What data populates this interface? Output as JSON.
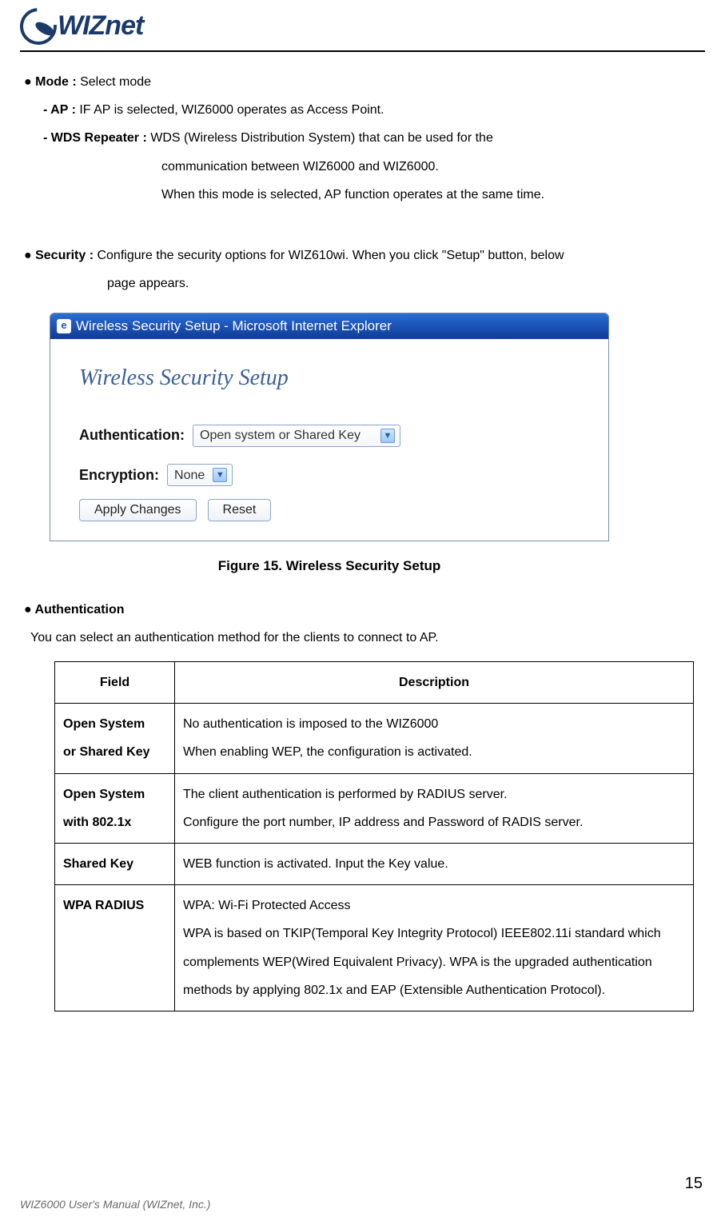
{
  "header": {
    "logo_text": "WIZnet"
  },
  "body": {
    "bullet_mode_label": "● Mode : ",
    "bullet_mode_value": "Select mode",
    "ap_label": "- AP : ",
    "ap_text": "IF AP is selected, WIZ6000 operates as Access Point.",
    "wds_label": "- WDS Repeater : ",
    "wds_text_l1": "WDS (Wireless Distribution System) that can be used for the",
    "wds_text_l2": "communication between WIZ6000 and WIZ6000.",
    "wds_text_l3": "When this mode is selected, AP function operates at the same time.",
    "sec_label": "● Security : ",
    "sec_text_l1": "Configure the security options for WIZ610wi. When you click \"Setup\" button, below",
    "sec_text_l2": "page appears.",
    "auth_label": "● Authentication",
    "auth_desc": "You can select an authentication method for the clients to connect to AP."
  },
  "screenshot": {
    "ie_icon_letter": "e",
    "title": "Wireless Security Setup - Microsoft Internet Explorer",
    "heading": "Wireless Security Setup",
    "auth_label": "Authentication:",
    "auth_value": "Open system or Shared Key",
    "enc_label": "Encryption:",
    "enc_value": "None",
    "apply_btn": "Apply Changes",
    "reset_btn": "Reset",
    "caret": "▼"
  },
  "figure_caption": "Figure 15. Wireless Security Setup",
  "table": {
    "h1": "Field",
    "h2": "Description",
    "rows": [
      {
        "field_l1": "Open System",
        "field_l2": "or Shared Key",
        "desc": "No authentication is imposed to the WIZ6000\nWhen enabling WEP, the configuration is activated."
      },
      {
        "field_l1": "Open System",
        "field_l2": "with 802.1x",
        "desc": "The client authentication is performed by RADIUS server.\nConfigure the port number, IP address and Password of RADIS server."
      },
      {
        "field_l1": "Shared Key",
        "field_l2": "",
        "desc": "WEB function is activated. Input the Key value."
      },
      {
        "field_l1": "WPA RADIUS",
        "field_l2": "",
        "desc": "WPA: Wi-Fi Protected Access\nWPA is based on TKIP(Temporal Key Integrity Protocol) IEEE802.11i standard which complements WEP(Wired Equivalent Privacy). WPA is the upgraded authentication methods by applying 802.1x and EAP (Extensible Authentication Protocol)."
      }
    ]
  },
  "footer": {
    "page": "15",
    "left_l1": "WIZ6000 User's Manual ",
    "left_l2": "(WIZnet, Inc.)"
  }
}
